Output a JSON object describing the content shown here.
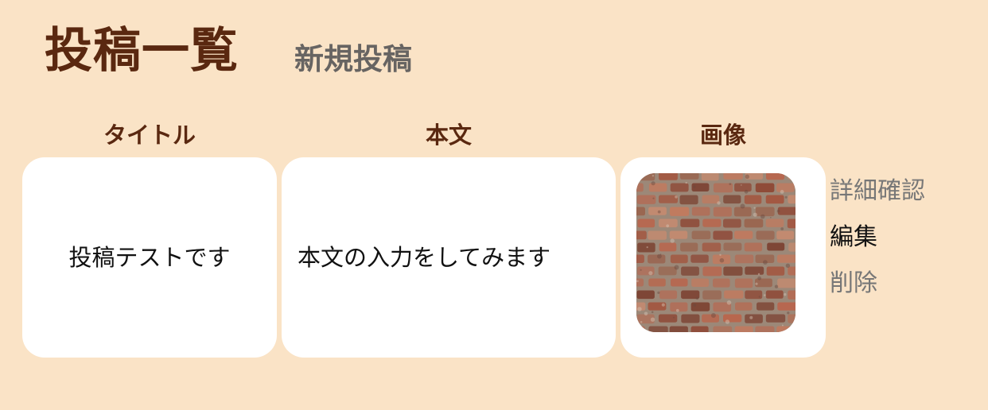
{
  "header": {
    "title": "投稿一覧",
    "new_post_label": "新規投稿"
  },
  "table": {
    "columns": [
      "タイトル",
      "本文",
      "画像"
    ],
    "rows": [
      {
        "title": "投稿テストです",
        "body": "本文の入力をしてみます",
        "image_icon": "brick-wall-photo",
        "actions": {
          "detail": "詳細確認",
          "edit": "編集",
          "delete": "削除"
        }
      }
    ]
  },
  "colors": {
    "background": "#fae3c6",
    "heading": "#5a2810",
    "muted_link": "#777777",
    "cell": "#ffffff"
  }
}
